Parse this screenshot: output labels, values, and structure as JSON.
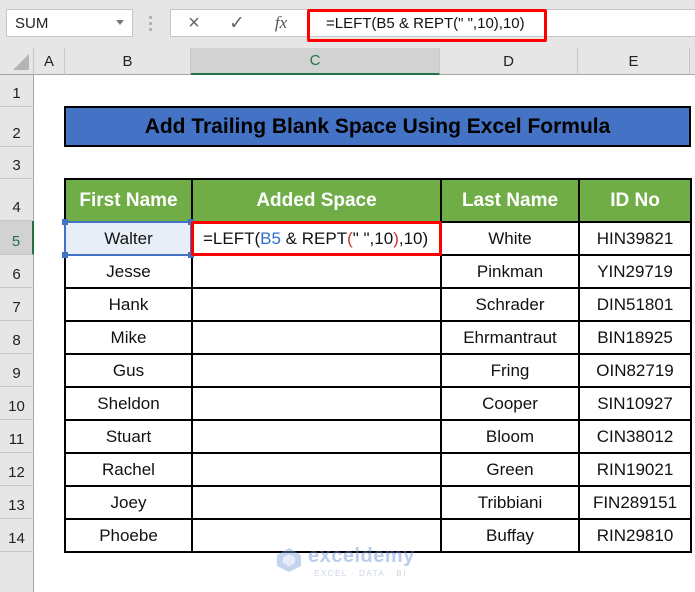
{
  "formula_bar": {
    "name_box": "SUM",
    "cancel_icon": "×",
    "enter_icon": "✓",
    "fx_label": "fx",
    "formula": "=LEFT(B5 & REPT(\" \",10),10)"
  },
  "columns": [
    "A",
    "B",
    "C",
    "D",
    "E"
  ],
  "active_column": "C",
  "rows": [
    "1",
    "2",
    "3",
    "4",
    "5",
    "6",
    "7",
    "8",
    "9",
    "10",
    "11",
    "12",
    "13",
    "14"
  ],
  "active_row": "5",
  "title": "Add Trailing Blank Space Using Excel Formula",
  "table": {
    "headers": [
      "First Name",
      "Added Space",
      "Last Name",
      "ID No"
    ],
    "rows": [
      {
        "first": "Walter",
        "added": "",
        "last": "White",
        "id": "HIN39821"
      },
      {
        "first": "Jesse",
        "added": "",
        "last": "Pinkman",
        "id": "YIN29719"
      },
      {
        "first": "Hank",
        "added": "",
        "last": "Schrader",
        "id": "DIN51801"
      },
      {
        "first": "Mike",
        "added": "",
        "last": "Ehrmantraut",
        "id": "BIN18925"
      },
      {
        "first": "Gus",
        "added": "",
        "last": "Fring",
        "id": "OIN82719"
      },
      {
        "first": "Sheldon",
        "added": "",
        "last": "Cooper",
        "id": "SIN10927"
      },
      {
        "first": "Stuart",
        "added": "",
        "last": "Bloom",
        "id": "CIN38012"
      },
      {
        "first": "Rachel",
        "added": "",
        "last": "Green",
        "id": "RIN19021"
      },
      {
        "first": "Joey",
        "added": "",
        "last": "Tribbiani",
        "id": "FIN289151"
      },
      {
        "first": "Phoebe",
        "added": "",
        "last": "Buffay",
        "id": "RIN29810"
      }
    ],
    "editing_cell": {
      "prefix": "=LEFT(",
      "ref": "B5",
      "mid": " & REPT",
      "open_paren": "(",
      "args": "\" \",10",
      "close_paren": ")",
      "suffix": ",10)"
    }
  },
  "watermark": {
    "name": "exceldemy",
    "tagline": "EXCEL · DATA · BI"
  },
  "colors": {
    "title_fill": "#4472c4",
    "header_fill": "#70ad47",
    "highlight": "#ff0000",
    "excel_green": "#217346"
  }
}
